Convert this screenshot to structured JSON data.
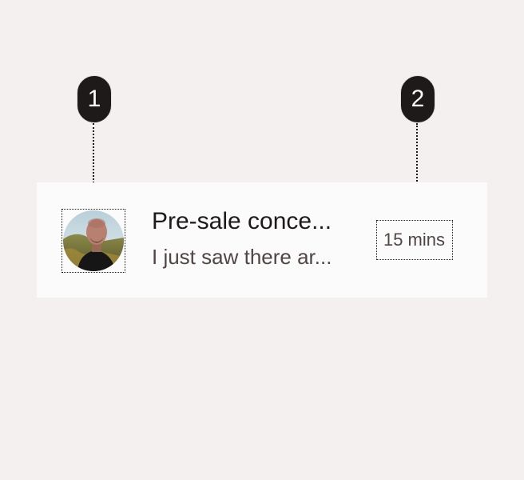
{
  "callouts": [
    {
      "number": "1"
    },
    {
      "number": "2"
    }
  ],
  "list_item": {
    "avatar_icon": "person-photo-avatar",
    "headline": "Pre-sale conce...",
    "supporting_text": "I just saw there ar...",
    "trailing_text": "15 mins"
  },
  "colors": {
    "background": "#f4f0f0",
    "surface": "#fcfbfb",
    "on_surface": "#1e1a1a",
    "on_surface_variant": "#504545",
    "badge": "#1e1a1a"
  }
}
